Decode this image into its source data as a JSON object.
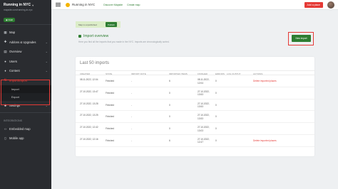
{
  "sidebar": {
    "title": "Running in NYC",
    "url": "mapsite.com/running-in-nyc",
    "badge": "Draft",
    "items": [
      {
        "label": "Map",
        "icon": "map-icon"
      },
      {
        "label": "Addons & Upgrades",
        "icon": "puzzle-icon"
      },
      {
        "label": "Overview",
        "icon": "chart-icon"
      },
      {
        "label": "Users",
        "icon": "users-icon"
      },
      {
        "label": "Content",
        "icon": "pin-icon"
      },
      {
        "label": "Import/Export",
        "icon": "swap-icon"
      },
      {
        "label": "Settings",
        "icon": "gear-icon"
      }
    ],
    "sub_items": [
      "Import",
      "Export"
    ],
    "integrations_label": "INTEGRATIONS",
    "integrations": [
      {
        "label": "Embedded map",
        "icon": "code-icon"
      },
      {
        "label": "Mobile app",
        "icon": "phone-icon"
      }
    ]
  },
  "header": {
    "app_name": "Running in NYC",
    "link_discover": "Discover Mapsite",
    "link_create": "Create map",
    "add_place": "Add a place"
  },
  "banner": {
    "text": "Map is unpublished",
    "publish": "Publish"
  },
  "overview": {
    "title": "Import overview",
    "desc": "Here you find all the imports that you made in the NYC. Imports are chronologically sorted.",
    "new_import": "New import"
  },
  "imports": {
    "title": "Last 50 imports",
    "columns": [
      "CREATED",
      "STATE",
      "IMPORT NOTE",
      "IMPORTED ITEMS",
      "FINISHED",
      "ERRORS",
      "LOG OUTPUT",
      "ACTIONS"
    ],
    "rows": [
      {
        "created": "08.11.2022, 12:04",
        "state": "Finished",
        "note": "-",
        "items": "6",
        "finished_date": "08.11.2022,",
        "finished_time": "12:04",
        "errors": "0",
        "log": "",
        "action": "Delete imported places"
      },
      {
        "created": "27.10.2022, 13:47",
        "state": "Finished",
        "note": "-",
        "items": "0",
        "finished_date": "27.10.2022,",
        "finished_time": "13:53",
        "errors": "0",
        "log": "",
        "action": ""
      },
      {
        "created": "27.10.2022, 13:28",
        "state": "Finished",
        "note": "-",
        "items": "0",
        "finished_date": "27.10.2022,",
        "finished_time": "13:53",
        "errors": "0",
        "log": "",
        "action": ""
      },
      {
        "created": "27.10.2022, 13:25",
        "state": "Finished",
        "note": "-",
        "items": "0",
        "finished_date": "27.10.2022,",
        "finished_time": "13:53",
        "errors": "0",
        "log": "",
        "action": ""
      },
      {
        "created": "27.10.2022, 12:42",
        "state": "Finished",
        "note": "-",
        "items": "0",
        "finished_date": "27.10.2022,",
        "finished_time": "13:03",
        "errors": "0",
        "log": "",
        "action": ""
      },
      {
        "created": "27.10.2022, 12:16",
        "state": "Finished",
        "note": "-",
        "items": "6",
        "finished_date": "27.10.2022,",
        "finished_time": "12:47",
        "errors": "0",
        "log": "",
        "action": "Delete imported places"
      }
    ]
  },
  "colors": {
    "accent": "#2e7d32",
    "danger": "#e53935",
    "sidebar": "#2a2c30"
  }
}
